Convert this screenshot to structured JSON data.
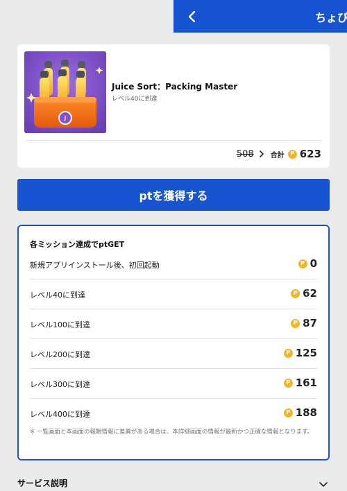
{
  "header": {
    "title": "ちょび",
    "back_icon": "chevron-left-icon",
    "color": "#1754d1"
  },
  "app_card": {
    "name": "Juice Sort：Packing Master",
    "condition": "レベル40に到達",
    "thumbnail_icon": "juice-bottles-crate-icon",
    "old_points": "508",
    "total_label": "合計",
    "coin_symbol": "P",
    "total_points": "623"
  },
  "cta": {
    "label": "ptを獲得する"
  },
  "missions": {
    "heading": "各ミッション達成でptGET",
    "items": [
      {
        "label": "新規アプリインストール後、初回起動",
        "points": "0"
      },
      {
        "label": "レベル40に到達",
        "points": "62"
      },
      {
        "label": "レベル100に到達",
        "points": "87"
      },
      {
        "label": "レベル200に到達",
        "points": "125"
      },
      {
        "label": "レベル300に到達",
        "points": "161"
      },
      {
        "label": "レベル400に到達",
        "points": "188"
      }
    ],
    "note": "※ 一覧画面と本画面の報酬情報に差異がある場合は、本詳細画面の情報が最新かつ正確な情報となります。"
  },
  "service": {
    "label": "サービス説明",
    "chevron_icon": "chevron-down-icon"
  },
  "colors": {
    "primary": "#1754d1",
    "coin": "#f4b524",
    "background": "#ebebeb"
  }
}
